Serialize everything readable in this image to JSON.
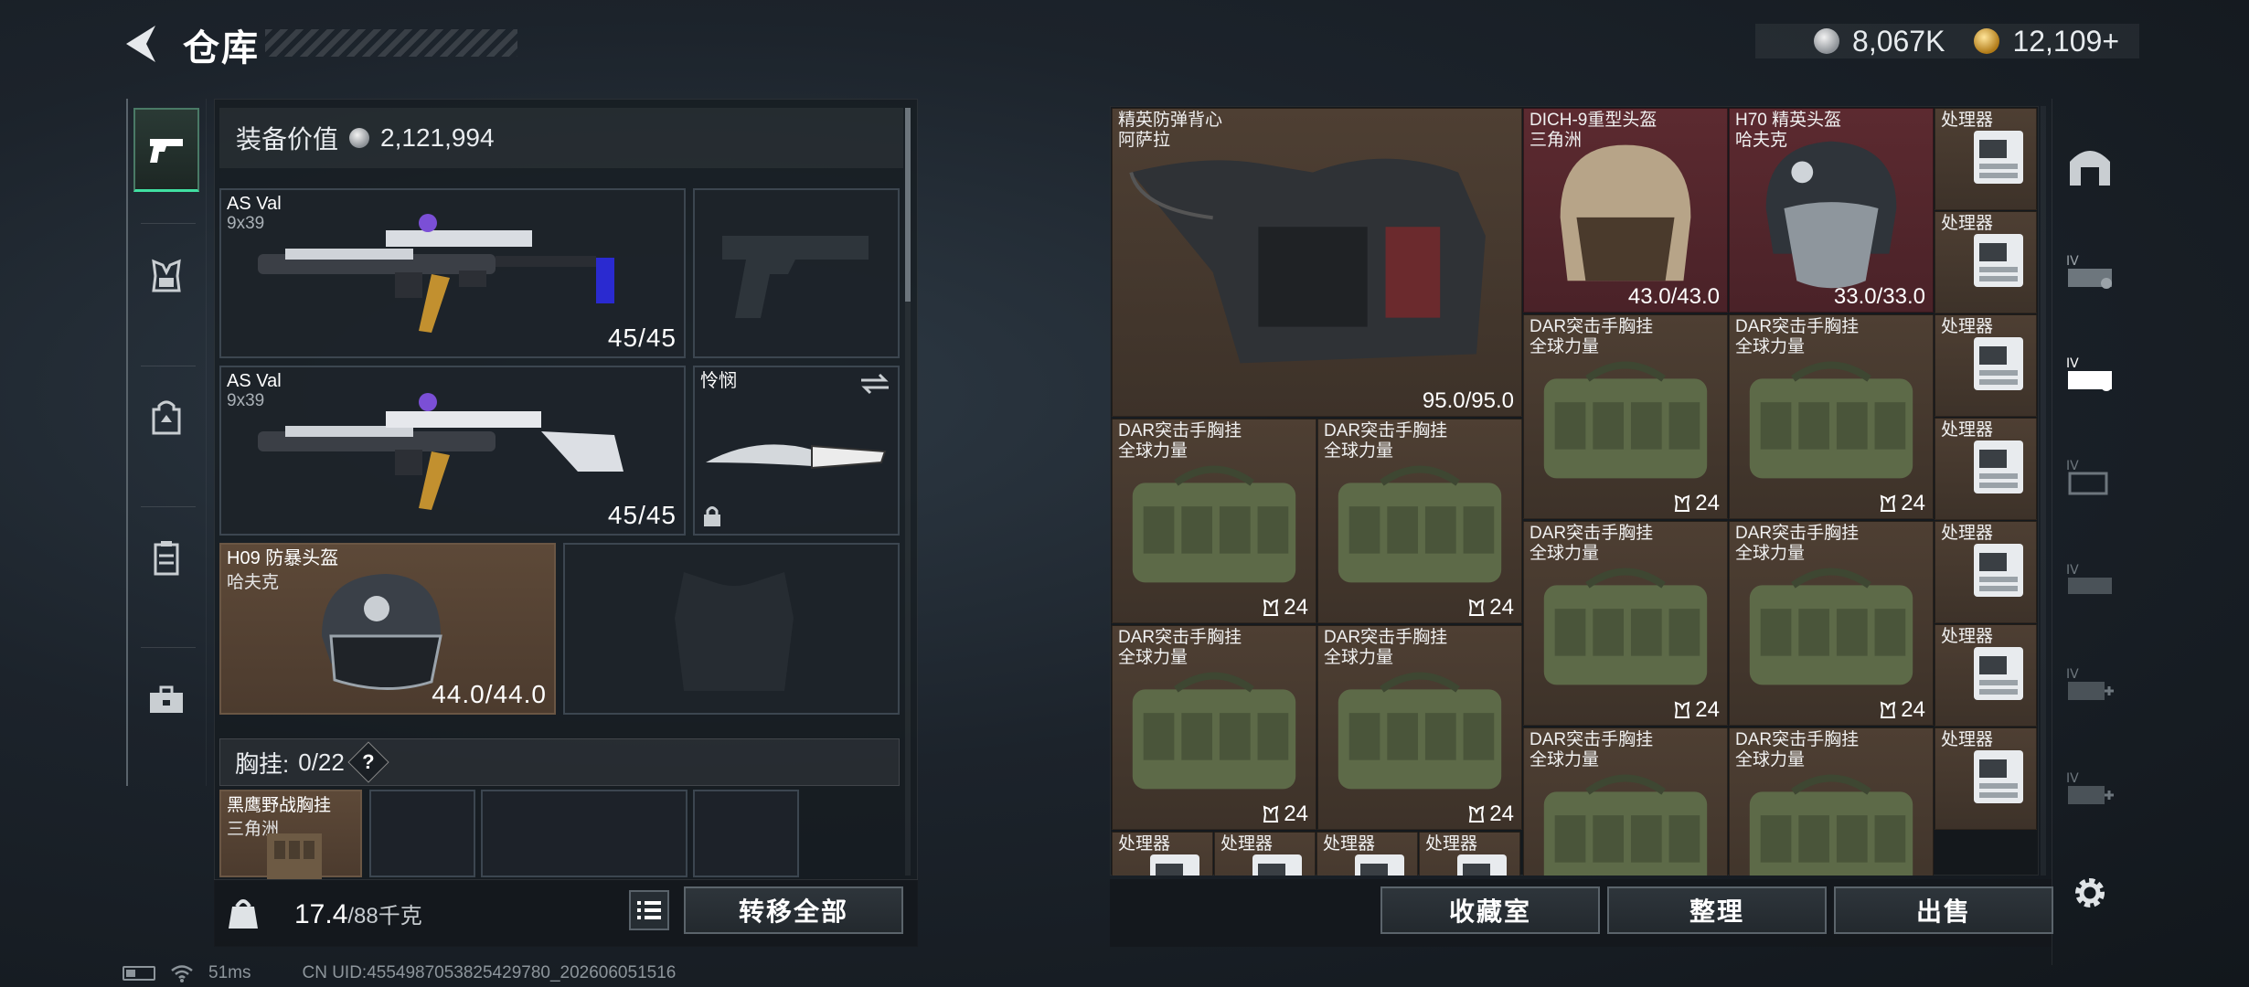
{
  "header": {
    "title": "仓库",
    "currency": [
      {
        "icon": "silver-coin-icon",
        "value": "8,067K"
      },
      {
        "icon": "gold-coin-icon",
        "value": "12,109+"
      }
    ]
  },
  "left_tabs": [
    {
      "name": "weapons",
      "icon": "pistol-icon",
      "active": true
    },
    {
      "name": "chest-rig",
      "icon": "chest-rig-icon"
    },
    {
      "name": "backpack",
      "icon": "backpack-icon"
    },
    {
      "name": "pouch",
      "icon": "pouch-icon"
    },
    {
      "name": "case",
      "icon": "briefcase-icon"
    }
  ],
  "equipment": {
    "value_label": "装备价值",
    "value": "2,121,994",
    "weapon1": {
      "name": "AS Val",
      "caliber": "9x39",
      "ammo": "45/45"
    },
    "weapon2": {
      "name": "AS Val",
      "caliber": "9x39",
      "ammo": "45/45"
    },
    "melee": {
      "name": "怜悯"
    },
    "helmet": {
      "name": "H09 防暴头盔",
      "brand": "哈夫克",
      "durability": "44.0/44.0"
    }
  },
  "chest": {
    "label": "胸挂:",
    "count": "0/22",
    "help": "?",
    "item": {
      "name": "黑鹰野战胸挂",
      "brand": "三角洲"
    }
  },
  "bottom_left": {
    "weight": "17.4",
    "weight_max": "/88千克",
    "transfer_all": "转移全部"
  },
  "storage": {
    "vest": {
      "name": "精英防弹背心",
      "brand": "阿萨拉",
      "durability": "95.0/95.0"
    },
    "helmets": [
      {
        "name": "DICH-9重型头盔",
        "brand": "三角洲",
        "durability": "43.0/43.0"
      },
      {
        "name": "H70 精英头盔",
        "brand": "哈夫克",
        "durability": "33.0/33.0"
      }
    ],
    "rig_name": "DAR突击手胸挂",
    "rig_brand": "全球力量",
    "rig_capacity": "24",
    "processor_name": "处理器"
  },
  "bottom_right": {
    "collection": "收藏室",
    "organize": "整理",
    "sell": "出售"
  },
  "status_bar": {
    "ping": "51ms",
    "uid": "CN UID:4554987053825429780_202606051516"
  },
  "colors": {
    "accent_green": "#40e0a2",
    "item_brown": "#4e3f33",
    "item_red": "#5c2a30"
  }
}
